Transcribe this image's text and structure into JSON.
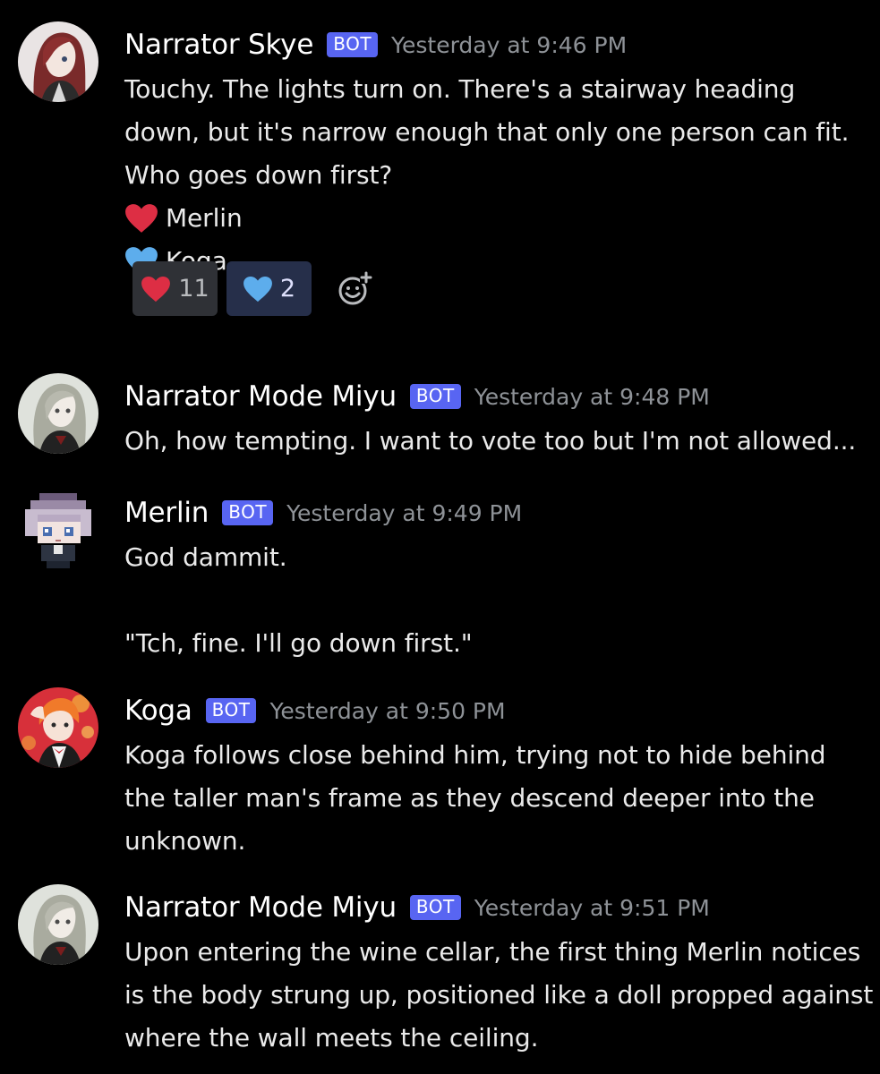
{
  "colors": {
    "background": "#000000",
    "bot_tag": "#5865f2",
    "timestamp": "#8e9297",
    "heart_red": "#dd2e44",
    "heart_blue": "#5dadec"
  },
  "messages": [
    {
      "author": "Narrator Skye",
      "bot_label": "BOT",
      "timestamp": "Yesterday at 9:46 PM",
      "lines": [
        "Touchy. The lights turn on. There's a stairway heading",
        "down, but it's narrow enough that only one person can fit.",
        "Who goes down first?"
      ],
      "options": [
        {
          "emoji": "red-heart-icon",
          "label": "Merlin"
        },
        {
          "emoji": "blue-heart-icon",
          "label": "Koga"
        }
      ],
      "reactions": [
        {
          "emoji": "red-heart-icon",
          "count": "11"
        },
        {
          "emoji": "blue-heart-icon",
          "count": "2"
        }
      ]
    },
    {
      "author": "Narrator Mode Miyu",
      "bot_label": "BOT",
      "timestamp": "Yesterday at 9:48 PM",
      "lines": [
        "Oh, how tempting. I want to vote too but I'm not allowed..."
      ]
    },
    {
      "author": "Merlin",
      "bot_label": "BOT",
      "timestamp": "Yesterday at 9:49 PM",
      "lines": [
        "God dammit.",
        "",
        "\"Tch, fine. I'll go down first.\""
      ]
    },
    {
      "author": "Koga",
      "bot_label": "BOT",
      "timestamp": "Yesterday at 9:50 PM",
      "lines": [
        "Koga follows close behind him, trying not to hide behind",
        "the taller man's frame as they descend deeper into the",
        "unknown."
      ]
    },
    {
      "author": "Narrator Mode Miyu",
      "bot_label": "BOT",
      "timestamp": "Yesterday at 9:51 PM",
      "lines": [
        "Upon entering the wine cellar, the first thing Merlin notices",
        "is the body strung up, positioned like a doll propped against",
        "where the wall meets the ceiling."
      ]
    }
  ]
}
